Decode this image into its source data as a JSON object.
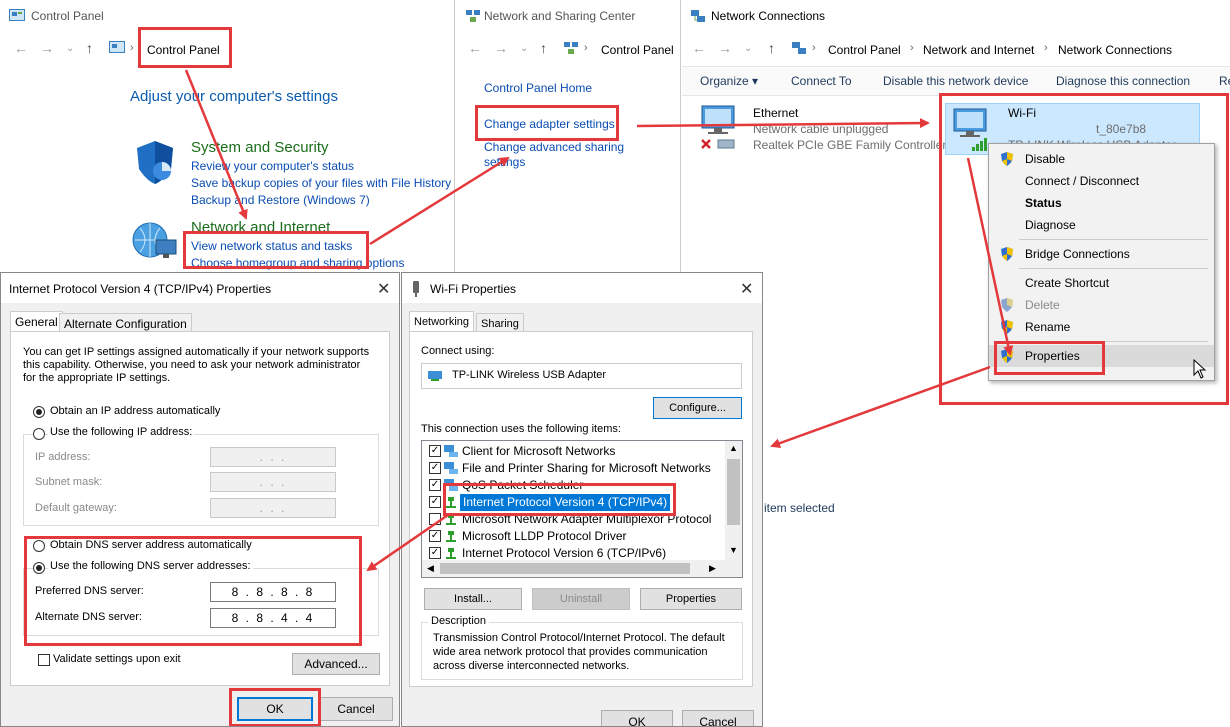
{
  "control_panel": {
    "title": "Control Panel",
    "address": "Control Panel",
    "heading": "Adjust your computer's settings",
    "categories": [
      {
        "name": "System and Security",
        "links": [
          "Review your computer's status",
          "Save backup copies of your files with File History",
          "Backup and Restore (Windows 7)"
        ]
      },
      {
        "name": "Network and Internet",
        "links": [
          "View network status and tasks",
          "Choose homegroup and sharing options"
        ]
      }
    ]
  },
  "nsc": {
    "title": "Network and Sharing Center",
    "address": "Control Panel",
    "links": [
      "Control Panel Home",
      "Change adapter settings",
      "Change advanced sharing",
      "settings"
    ]
  },
  "netconn": {
    "title": "Network Connections",
    "breadcrumb": [
      "Control Panel",
      "Network and Internet",
      "Network Connections"
    ],
    "toolbar": [
      "Organize ▾",
      "Connect To",
      "Disable this network device",
      "Diagnose this connection",
      "Re"
    ],
    "ethernet": {
      "name": "Ethernet",
      "status": "Network cable unplugged",
      "device": "Realtek PCIe GBE Family Controller"
    },
    "wifi": {
      "name": "Wi-Fi",
      "ssid": "t_80e7b8",
      "device": "TP-LINK Wireless USB Adapter"
    },
    "status_text": "item selected",
    "context_menu": [
      "Disable",
      "Connect / Disconnect",
      "Status",
      "Diagnose",
      "Bridge Connections",
      "Create Shortcut",
      "Delete",
      "Rename",
      "Properties"
    ]
  },
  "ipv4": {
    "title": "Internet Protocol Version 4 (TCP/IPv4) Properties",
    "tabs": [
      "General",
      "Alternate Configuration"
    ],
    "intro": [
      "You can get IP settings assigned automatically if your network supports",
      "this capability. Otherwise, you need to ask your network administrator",
      "for the appropriate IP settings."
    ],
    "radio_auto_ip": "Obtain an IP address automatically",
    "radio_manual_ip": "Use the following IP address:",
    "ip_label": "IP address:",
    "subnet_label": "Subnet mask:",
    "gateway_label": "Default gateway:",
    "empty_ip": ".     .     .",
    "radio_auto_dns": "Obtain DNS server address automatically",
    "radio_manual_dns": "Use the following DNS server addresses:",
    "pref_dns_label": "Preferred DNS server:",
    "pref_dns": "8 . 8 . 8 . 8",
    "alt_dns_label": "Alternate DNS server:",
    "alt_dns": "8 . 8 . 4 . 4",
    "validate": "Validate settings upon exit",
    "advanced": "Advanced...",
    "ok": "OK",
    "cancel": "Cancel"
  },
  "wifiprops": {
    "title": "Wi-Fi Properties",
    "tabs": [
      "Networking",
      "Sharing"
    ],
    "connect_using": "Connect using:",
    "adapter": "TP-LINK Wireless USB Adapter",
    "configure": "Configure...",
    "items_label": "This connection uses the following items:",
    "items": [
      "Client for Microsoft Networks",
      "File and Printer Sharing for Microsoft Networks",
      "QoS Packet Scheduler",
      "Internet Protocol Version 4 (TCP/IPv4)",
      "Microsoft Network Adapter Multiplexor Protocol",
      "Microsoft LLDP Protocol Driver",
      "Internet Protocol Version 6 (TCP/IPv6)"
    ],
    "install": "Install...",
    "uninstall": "Uninstall",
    "properties": "Properties",
    "description_label": "Description",
    "description": [
      "Transmission Control Protocol/Internet Protocol. The default",
      "wide area network protocol that provides communication",
      "across diverse interconnected networks."
    ],
    "ok": "OK",
    "cancel": "Cancel"
  },
  "colors": {
    "annotation": "#e4393c",
    "link": "#0a4db3",
    "selection": "#0078d7"
  }
}
